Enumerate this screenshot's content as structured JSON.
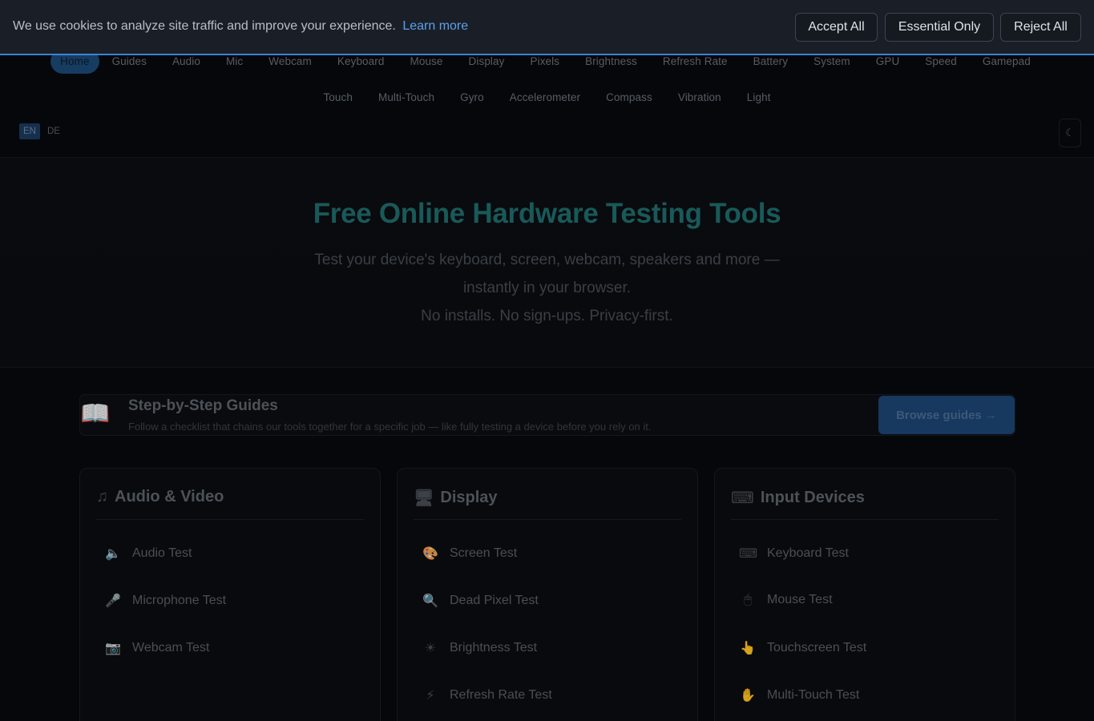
{
  "cookie": {
    "message": "We use cookies to analyze site traffic and improve your experience.",
    "learn_more": "Learn more",
    "accept_all": "Accept All",
    "essential_only": "Essential Only",
    "reject_all": "Reject All"
  },
  "nav": {
    "row1": [
      "Home",
      "Guides",
      "Audio",
      "Mic",
      "Webcam",
      "Keyboard",
      "Mouse",
      "Display",
      "Pixels",
      "Brightness",
      "Refresh Rate",
      "Battery",
      "System",
      "GPU",
      "Speed",
      "Gamepad"
    ],
    "row2": [
      "Touch",
      "Multi-Touch",
      "Gyro",
      "Accelerometer",
      "Compass",
      "Vibration",
      "Light"
    ],
    "active": "Home"
  },
  "lang": {
    "en": "EN",
    "de": "DE",
    "selected": "EN"
  },
  "theme_toggle": {
    "icon": "moon-icon",
    "glyph": "☾"
  },
  "hero": {
    "title": "Free Online Hardware Testing Tools",
    "line1": "Test your device's keyboard, screen, webcam, speakers and more —",
    "line2": "instantly in your browser.",
    "line3": "No installs. No sign-ups. Privacy-first."
  },
  "guides": {
    "icon": "book-icon",
    "title": "Step-by-Step Guides",
    "description": "Follow a checklist that chains our tools together for a specific job — like fully testing a device before you rely on it.",
    "button": "Browse guides →"
  },
  "categories": [
    {
      "title": "Audio & Video",
      "icon": "music-note-icon",
      "items": [
        {
          "label": "Audio Test",
          "icon": "speaker-icon"
        },
        {
          "label": "Microphone Test",
          "icon": "microphone-icon"
        },
        {
          "label": "Webcam Test",
          "icon": "camera-icon"
        }
      ]
    },
    {
      "title": "Display",
      "icon": "monitor-icon",
      "items": [
        {
          "label": "Screen Test",
          "icon": "palette-icon"
        },
        {
          "label": "Dead Pixel Test",
          "icon": "magnifier-icon"
        },
        {
          "label": "Brightness Test",
          "icon": "sun-icon"
        },
        {
          "label": "Refresh Rate Test",
          "icon": "lightning-icon"
        }
      ]
    },
    {
      "title": "Input Devices",
      "icon": "keyboard-icon",
      "items": [
        {
          "label": "Keyboard Test",
          "icon": "keyboard-icon"
        },
        {
          "label": "Mouse Test",
          "icon": "mouse-icon"
        },
        {
          "label": "Touchscreen Test",
          "icon": "pointing-hand-icon"
        },
        {
          "label": "Multi-Touch Test",
          "icon": "hand-icon"
        }
      ]
    }
  ],
  "colors": {
    "accent": "#3c82d8",
    "link": "#5aa0ec",
    "hero_title": "#1f6d6d"
  }
}
